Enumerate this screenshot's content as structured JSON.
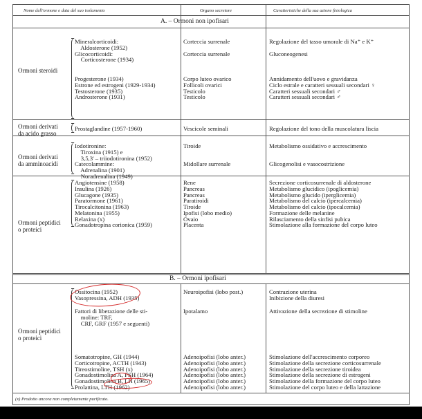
{
  "table": {
    "headers": {
      "name": "Nome dell'ormone e data del suo isolamento",
      "organ": "Organo secretore",
      "action": "Caratteristiche della sua azione fisiologica"
    },
    "sections": {
      "a_title": "A. – Ormoni non ipofisari",
      "b_title": "B. – Ormoni ipofisari"
    },
    "groups": {
      "steroidi": "Ormoni steroidi",
      "grasso": "Ormoni derivati\nda acido grasso",
      "amminoacidi": "Ormoni derivati\nda amminoacidi",
      "peptidici_a": "Ormoni peptidici\no proteici",
      "peptidici_b": "Ormoni peptidici\no proteici"
    },
    "steroidi1": {
      "names": "Mineralcorticoidi:\n    Aldosterone (1952)\nGlicocorticoidi:\n    Corticosterone (1934)",
      "organs": "Corteccia surrenale\n\nCorteccia surrenale",
      "actions": "Regolazione del tasso umorale di Na⁺ e K⁺\n\nGluconeogenesi"
    },
    "steroidi2": {
      "names": "Progesterone (1934)\nEstrone ed estrogeni (1929-1934)\nTestosterone (1935)\nAndrosterone (1931)",
      "organs": "Corpo luteo ovarico\nFollicoli ovarici\nTesticolo\nTesticolo",
      "actions": "Annidamento dell'uovo e gravidanza\nCiclo estrale e caratteri sessuali secondari ♀\nCaratteri sessuali secondari ♂\nCaratteri sessuali secondari ♂"
    },
    "grasso": {
      "names": "Prostaglandine (1957-1960)",
      "organs": "Vescicole seminali",
      "actions": "Regolazione del tono della muscolatura liscia"
    },
    "ammino1": {
      "names": "Iodotironine:\n    Tiroxina (1915) e\n    3,5,3' – triiodotironina (1952)\nCatecolammine:\n    Adrenalina (1901)\n    Noradrenalina (1949)",
      "organs": "Tiroide\n\n\nMidollare surrenale",
      "actions": "Metabolismo ossidativo e accrescimento\n\n\nGlicogenolisi e vasocostrizione"
    },
    "peptidi_a": {
      "names": "Angiotensine (1958)\nInsulina (1926)\nGlucagone (1935)\nParatormone (1961)\nTirocalcitonina (1963)\nMelatonina (1955)\nRelaxina (x)\nGonadotropina corionica (1959)",
      "organs": "Rene\nPancreas\nPancreas\nParatiroidi\nTiroide\nIpofisi (lobo medio)\nOvaio\nPlacenta",
      "actions": "Secrezione corticosurrenale di aldosterone\nMetabolismo glucidico (ipoglicemia)\nMetabolismo glucido (iperglicemia)\nMetabolismo del calcio (ipercalcemia)\nMetabolismo del calcio (ipocalcemia)\nFormazione delle melanine\nRilasciamento della sinfisi pubica\nStimolazione alla formazione del corpo luteo"
    },
    "neuro": {
      "names": "Ossitocina (1952)\nVasopressina, ADH (1935)",
      "organs": "Neuroipofisi (lobo post.)",
      "actions": "Contrazione uterina\nInibizione della diuresi"
    },
    "fattori": {
      "names": "Fattori di liberazione delle sti-\n    moline: TRF,\n    CRF, GRF (1957 e seguenti)",
      "organs": "Ipotalamo",
      "actions": "Attivazione della secrezione di stimoline"
    },
    "adeno": {
      "names": "Somatotropine, GH (1944)\nCorticotropine, ACTH (1943)\nTireostimoline, TSH (x)\nGonadostimolina A, FSH (1964)\nGonadostimolina B, LH (1965)\nProlattina, LTH (1962)",
      "organs": "Adenoipofisi (lobo anter.)\nAdenoipofisi (lobo anter.)\nAdenoipofisi (lobo anter.)\nAdenoipofisi (lobo anter.)\nAdenoipofisi (lobo anter.)\nAdenoipofisi (lobo anter.)",
      "actions": "Stimolazione dell'accrescimento corporeo\nStimolazione della secrezione corticosurrenale\nStimolazione della secrezione tiroidea\nStimolazione della secrezione di estrogeni\nStimolazione della formazione del corpo luteo\nStimolazione del corpo luteo e della lattazione"
    },
    "footnote": "(x) Prodotto ancora non completamente purificato."
  },
  "annotations": {
    "color": "#d42a2a"
  }
}
